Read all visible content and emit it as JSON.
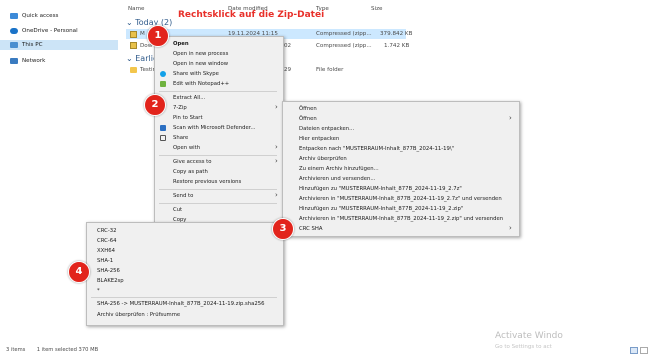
{
  "annotation": "Rechtsklick auf die Zip-Datei",
  "sidebar": {
    "items": [
      {
        "label": "Quick access",
        "color": "#3c8ad8"
      },
      {
        "label": "OneDrive - Personal",
        "color": "#1a73c8"
      },
      {
        "label": "This PC",
        "color": "#4a8fd0"
      },
      {
        "label": "Network",
        "color": "#3a7bc0"
      }
    ]
  },
  "columns": {
    "name": "Name",
    "date": "Date modified",
    "type": "Type",
    "size": "Size"
  },
  "groups": {
    "today": "Today (2)",
    "earlier": "Earlier t"
  },
  "files": [
    {
      "name": "M",
      "date": "19.11.2024 11:15",
      "type": "Compressed (zipp...",
      "size": "379.842 KB"
    },
    {
      "name": "Dow",
      "date": "02",
      "type": "Compressed (zipp...",
      "size": "1.742 KB"
    },
    {
      "name": "Testin",
      "date": "29",
      "type": "File folder",
      "size": ""
    }
  ],
  "menu1": {
    "items": [
      "Open",
      "Open in new process",
      "Open in new window",
      "Share with Skype",
      "Edit with Notepad++",
      "Extract All...",
      "7-Zip",
      "Pin to Start",
      "Scan with Microsoft Defender...",
      "Share",
      "Open with",
      "Give access to",
      "Copy as path",
      "Restore previous versions",
      "Send to",
      "Cut",
      "Copy"
    ]
  },
  "menu2": {
    "items": [
      "Öffnen",
      "Öffnen",
      "Dateien entpacken...",
      "Hier entpacken",
      "Entpacken nach \"MUSTERRAUM-Inhalt_877B_2024-11-19\\\"",
      "Archiv überprüfen",
      "Zu einem Archiv hinzufügen...",
      "Archivieren und versenden...",
      "Hinzufügen zu \"MUSTERRAUM-Inhalt_877B_2024-11-19_2.7z\"",
      "Archivieren in \"MUSTERRAUM-Inhalt_877B_2024-11-19_2.7z\" und versenden",
      "Hinzufügen zu \"MUSTERRAUM-Inhalt_877B_2024-11-19_2.zip\"",
      "Archivieren in \"MUSTERRAUM-Inhalt_877B_2024-11-19_2.zip\" und versenden",
      "CRC SHA"
    ]
  },
  "menu3": {
    "items": [
      "CRC-32",
      "CRC-64",
      "XXH64",
      "SHA-1",
      "SHA-256",
      "BLAKE2sp",
      "*",
      "SHA-256 -> MUSTERRAUM-Inhalt_877B_2024-11-19.zip.sha256",
      "Archiv überprüfen : Prüfsumme"
    ]
  },
  "badges": [
    "1",
    "2",
    "3",
    "4"
  ],
  "status": {
    "items": "3 items",
    "selected": "1 item selected  370 MB"
  },
  "watermark": {
    "line1": "Activate Windo",
    "line2": "Go to Settings to act"
  },
  "colors": {
    "badge": "#e2241c",
    "annotation": "#e8302a",
    "selection": "#cce4f7"
  }
}
